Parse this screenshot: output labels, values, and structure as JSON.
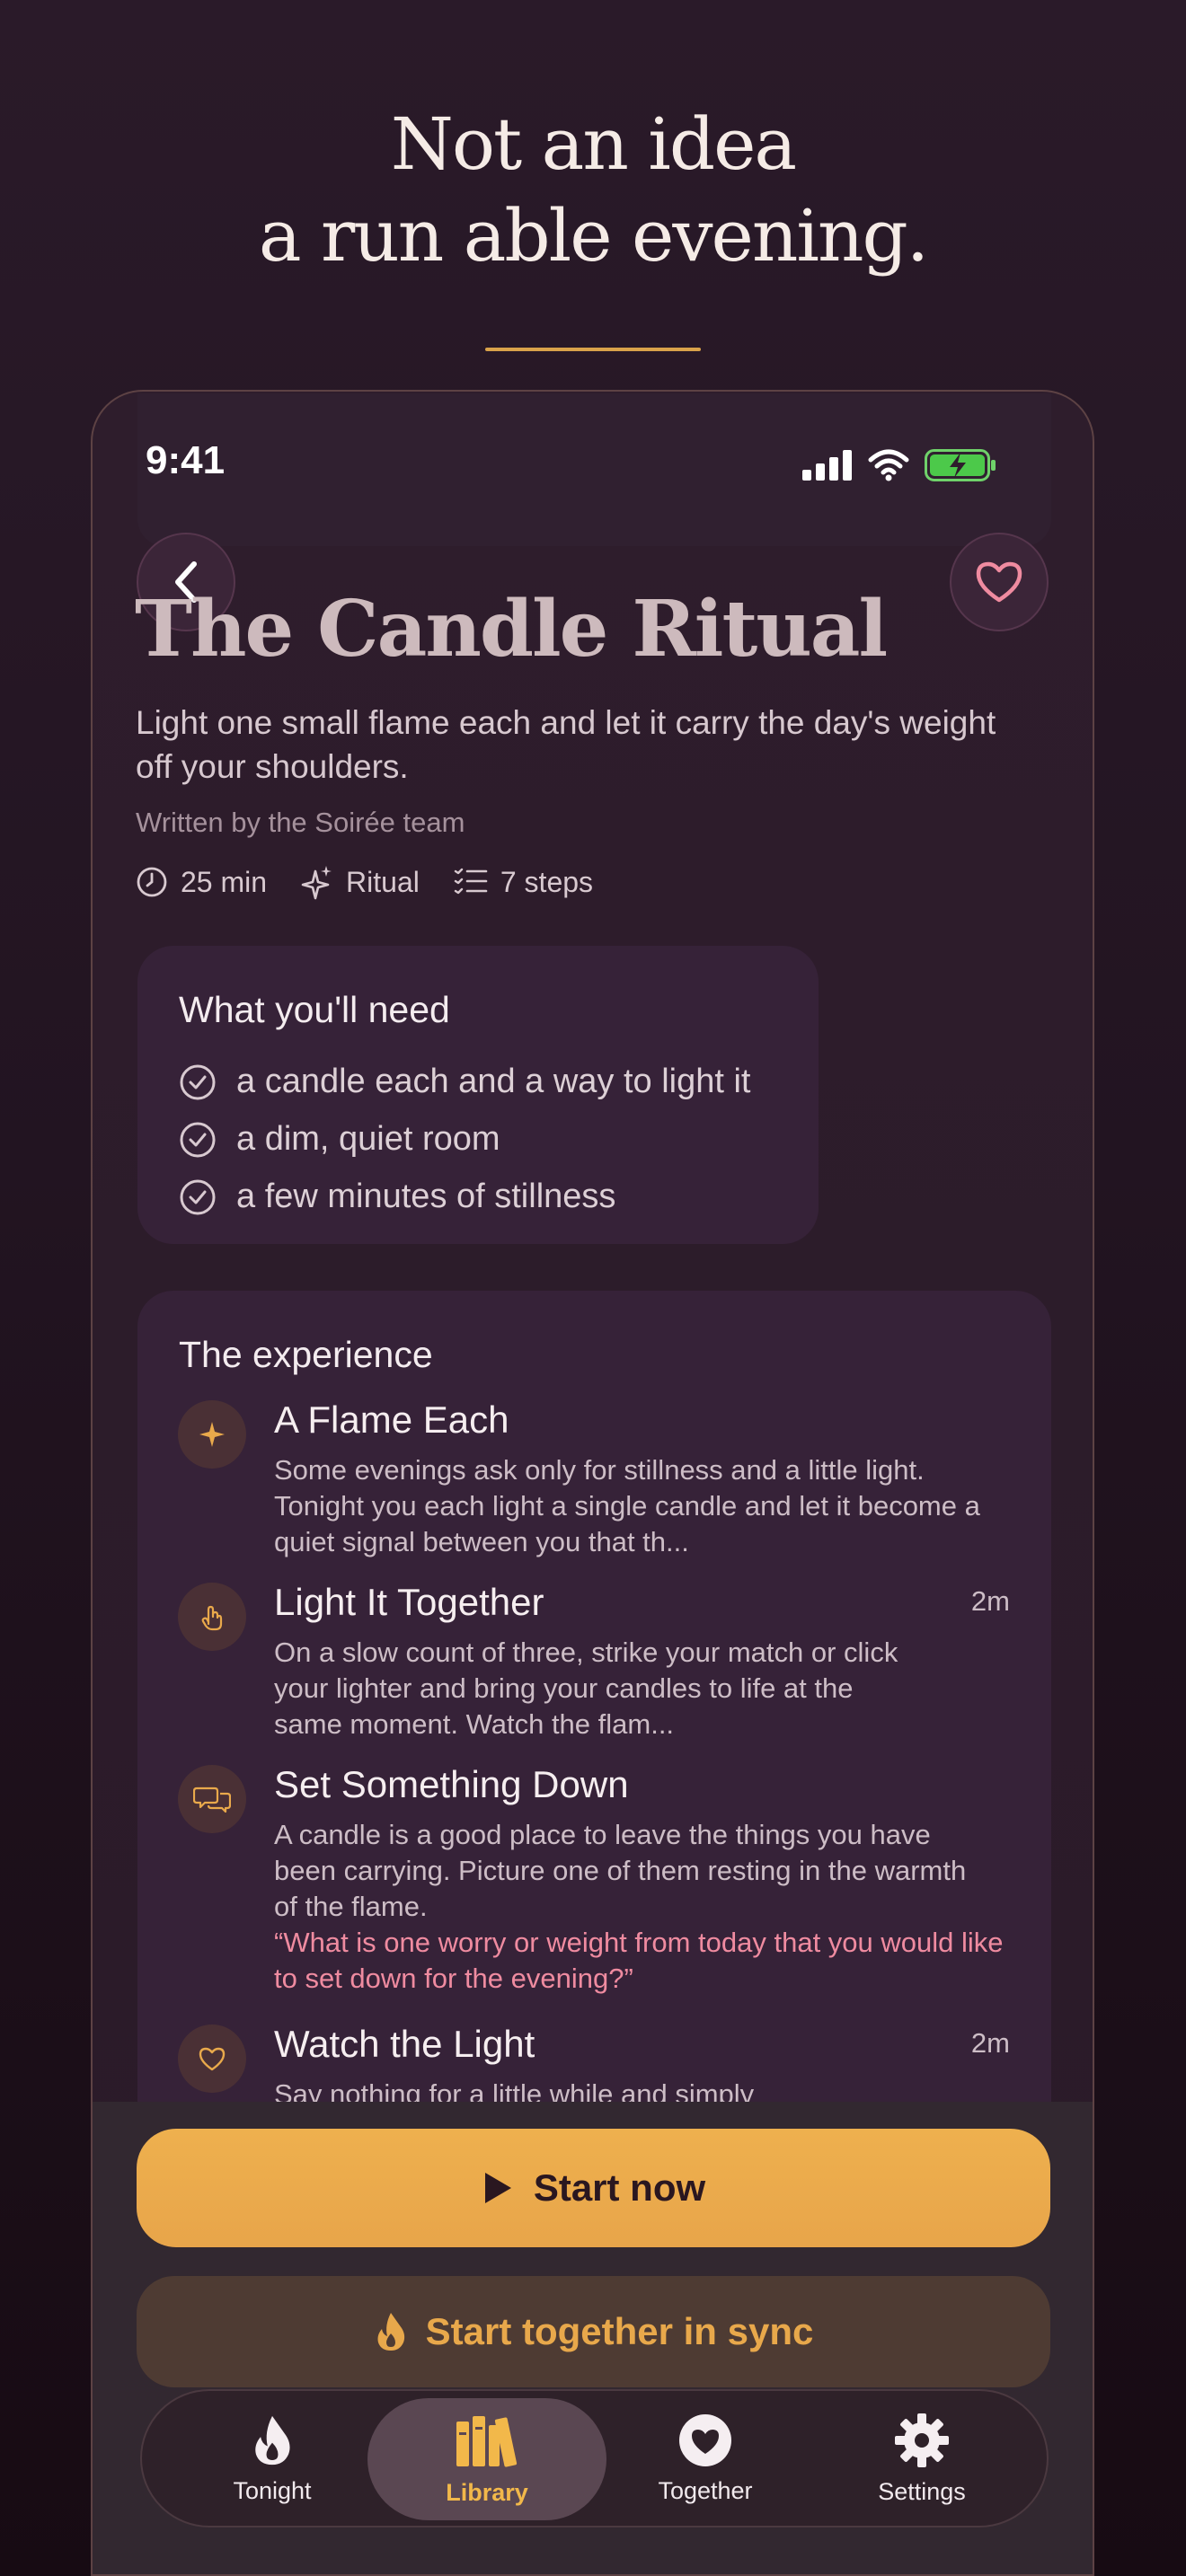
{
  "headline": {
    "line1": "Not an idea",
    "line2": "a run able evening."
  },
  "status": {
    "time": "9:41"
  },
  "recipe": {
    "title": "The Candle Ritual",
    "subtitle": "Light one small flame each and let it carry the day's weight off your shoulders.",
    "byline": "Written by the Soirée team",
    "meta": {
      "duration": "25 min",
      "category": "Ritual",
      "steps": "7 steps"
    }
  },
  "needs": {
    "title": "What you'll need",
    "items": [
      "a candle each and a way to light it",
      "a dim, quiet room",
      "a few minutes of stillness"
    ]
  },
  "experience": {
    "title": "The experience",
    "steps": [
      {
        "title": "A Flame Each",
        "body": "Some evenings ask only for stillness and a little light. Tonight you each light a single candle and let it become a quiet signal between you that th...",
        "duration": "",
        "icon": "sparkle-icon"
      },
      {
        "title": "Light It Together",
        "body": "On a slow count of three, strike your match or click your lighter and bring your candles to life at the same moment. Watch the flam...",
        "duration": "2m",
        "icon": "hand-icon"
      },
      {
        "title": "Set Something Down",
        "body": "A candle is a good place to leave the things you have been carrying. Picture one of them resting in the warmth of the flame.",
        "quote": "“What is one worry or weight from today that you would like to set down for the evening?”",
        "duration": "",
        "icon": "chat-bubbles-icon"
      },
      {
        "title": "Watch the Light",
        "body": "Say nothing for a little while and simply",
        "duration": "2m",
        "icon": "heart-outline-icon"
      }
    ]
  },
  "actions": {
    "start_now": "Start now",
    "start_sync": "Start together in sync"
  },
  "tabs": [
    {
      "label": "Tonight",
      "icon": "flame-icon"
    },
    {
      "label": "Library",
      "icon": "books-icon",
      "active": true
    },
    {
      "label": "Together",
      "icon": "heart-icon"
    },
    {
      "label": "Settings",
      "icon": "gear-icon"
    }
  ],
  "colors": {
    "accent": "#eeb04e",
    "quote": "#ef8ba0",
    "background": "#2a1a29"
  }
}
